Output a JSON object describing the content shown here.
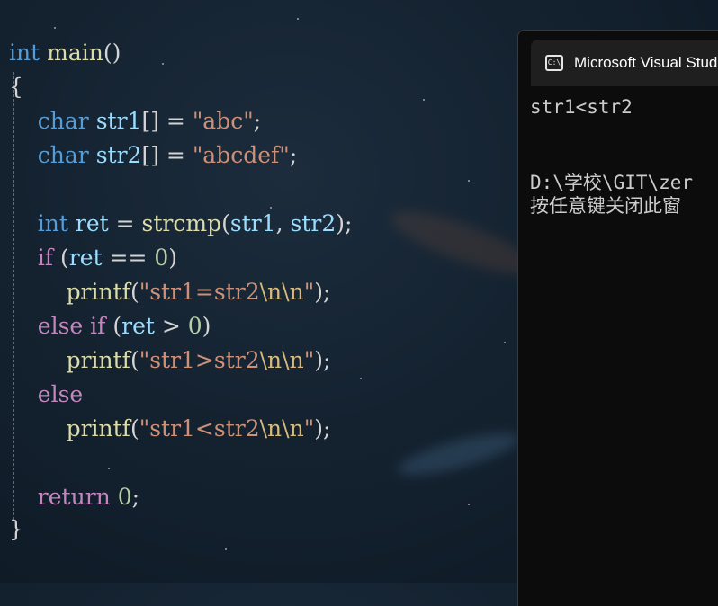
{
  "editor": {
    "lines": [
      [
        "int",
        " ",
        "main",
        "()"
      ],
      [
        "{"
      ],
      [
        "    ",
        "char",
        " ",
        "str1",
        "[] = ",
        "\"abc\"",
        ";"
      ],
      [
        "    ",
        "char",
        " ",
        "str2",
        "[] = ",
        "\"abcdef\"",
        ";"
      ],
      [],
      [
        "    ",
        "int",
        " ",
        "ret",
        " = ",
        "strcmp",
        "(",
        "str1",
        ", ",
        "str2",
        ");"
      ],
      [
        "    ",
        "if",
        " (",
        "ret",
        " == ",
        "0",
        ")"
      ],
      [
        "        ",
        "printf",
        "(",
        "\"str1=str2",
        "\\n\\n",
        "\"",
        ");"
      ],
      [
        "    ",
        "else",
        " ",
        "if",
        " (",
        "ret",
        " > ",
        "0",
        ")"
      ],
      [
        "        ",
        "printf",
        "(",
        "\"str1>str2",
        "\\n\\n",
        "\"",
        ");"
      ],
      [
        "    ",
        "else"
      ],
      [
        "        ",
        "printf",
        "(",
        "\"str1<str2",
        "\\n\\n",
        "\"",
        ");"
      ],
      [],
      [
        "    ",
        "return",
        " ",
        "0",
        ";"
      ],
      [
        "}"
      ]
    ]
  },
  "console": {
    "tab_title": "Microsoft Visual Studio",
    "icon": "terminal-icon",
    "icon_glyph": "C:\\",
    "output_line_1": "str1<str2",
    "output_line_2": "D:\\学校\\GIT\\zer",
    "output_line_3": "按任意键关闭此窗"
  }
}
